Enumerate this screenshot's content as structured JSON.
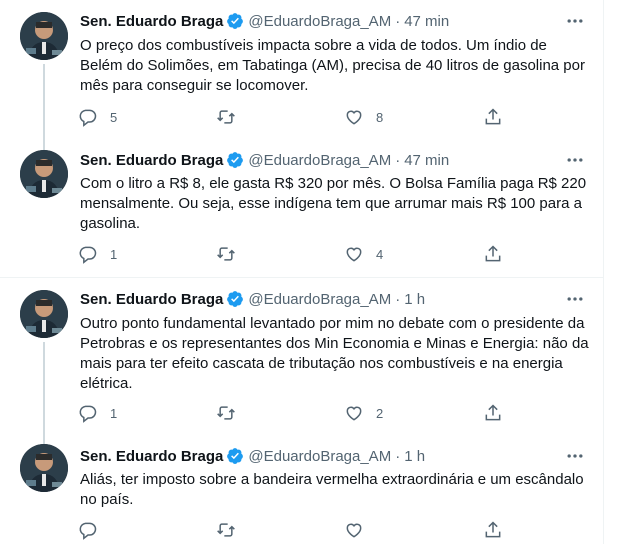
{
  "tweets": [
    {
      "name": "Sen. Eduardo Braga",
      "handle": "@EduardoBraga_AM",
      "sep": "·",
      "time": "47 min",
      "text": "O preço dos combustíveis impacta sobre a vida de todos. Um índio de Belém do Solimões, em Tabatinga (AM), precisa de 40 litros de gasolina por mês para conseguir se locomover.",
      "replies": "5",
      "retweets": "",
      "likes": "8"
    },
    {
      "name": "Sen. Eduardo Braga",
      "handle": "@EduardoBraga_AM",
      "sep": "·",
      "time": "47 min",
      "text": "Com o litro a R$ 8, ele gasta R$ 320 por mês. O Bolsa Família paga R$ 220 mensalmente. Ou seja, esse indígena tem que arrumar mais R$ 100 para a gasolina.",
      "replies": "1",
      "retweets": "",
      "likes": "4"
    },
    {
      "name": "Sen. Eduardo Braga",
      "handle": "@EduardoBraga_AM",
      "sep": "·",
      "time": "1 h",
      "text": "Outro ponto fundamental levantado por mim no debate com o presidente da Petrobras e os representantes dos Min Economia e Minas e Energia: não da mais para ter efeito cascata de tributação nos combustíveis e na energia elétrica.",
      "replies": "1",
      "retweets": "",
      "likes": "2"
    },
    {
      "name": "Sen. Eduardo Braga",
      "handle": "@EduardoBraga_AM",
      "sep": "·",
      "time": "1 h",
      "text": "Aliás, ter imposto sobre a bandeira vermelha extraordinária e um escândalo no país.",
      "replies": "",
      "retweets": "",
      "likes": ""
    }
  ],
  "colors": {
    "verified": "#1d9bf0",
    "muted": "#536471",
    "text": "#0f1419",
    "thread_line": "#cfd9de",
    "divider": "#eff3f4"
  },
  "icons": [
    "verified-badge-icon",
    "more-icon",
    "reply-icon",
    "retweet-icon",
    "like-icon",
    "share-icon"
  ]
}
